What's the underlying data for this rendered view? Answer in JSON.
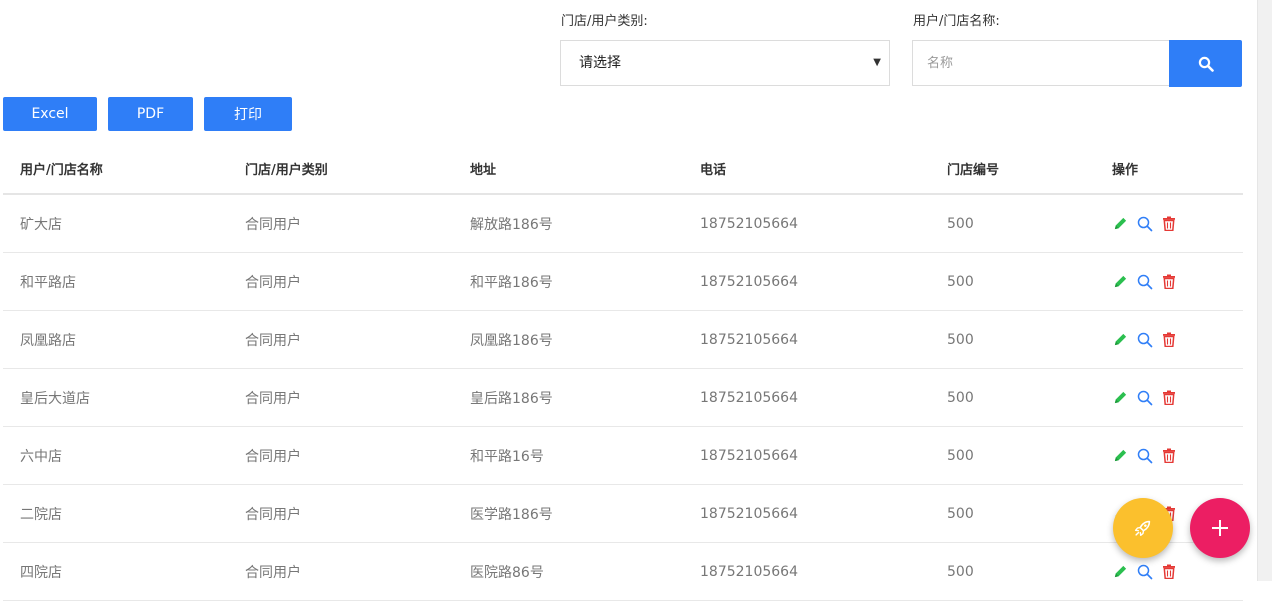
{
  "filters": {
    "category_label": "门店/用户类别:",
    "category_selected": "请选择",
    "name_label": "用户/门店名称:",
    "name_placeholder": "名称"
  },
  "toolbar": {
    "excel_label": "Excel",
    "pdf_label": "PDF",
    "print_label": "打印"
  },
  "table": {
    "headers": [
      "用户/门店名称",
      "门店/用户类别",
      "地址",
      "电话",
      "门店编号",
      "操作"
    ],
    "rows": [
      {
        "name": "矿大店",
        "category": "合同用户",
        "address": "解放路186号",
        "phone": "18752105664",
        "store_no": "500"
      },
      {
        "name": "和平路店",
        "category": "合同用户",
        "address": "和平路186号",
        "phone": "18752105664",
        "store_no": "500"
      },
      {
        "name": "凤凰路店",
        "category": "合同用户",
        "address": "凤凰路186号",
        "phone": "18752105664",
        "store_no": "500"
      },
      {
        "name": "皇后大道店",
        "category": "合同用户",
        "address": "皇后路186号",
        "phone": "18752105664",
        "store_no": "500"
      },
      {
        "name": "六中店",
        "category": "合同用户",
        "address": "和平路16号",
        "phone": "18752105664",
        "store_no": "500"
      },
      {
        "name": "二院店",
        "category": "合同用户",
        "address": "医学路186号",
        "phone": "18752105664",
        "store_no": "500"
      },
      {
        "name": "四院店",
        "category": "合同用户",
        "address": "医院路86号",
        "phone": "18752105664",
        "store_no": "500"
      }
    ]
  },
  "icons": {
    "edit": "pencil-icon",
    "view": "search-icon",
    "delete": "trash-icon",
    "fab_primary": "rocket-icon",
    "fab_secondary": "plus-icon"
  },
  "colors": {
    "primary": "#2f7ef7",
    "edit": "#2bbf4f",
    "view": "#2f7ef7",
    "delete": "#e53935",
    "fab_yellow": "#fbc02d",
    "fab_pink": "#ec1e63"
  }
}
